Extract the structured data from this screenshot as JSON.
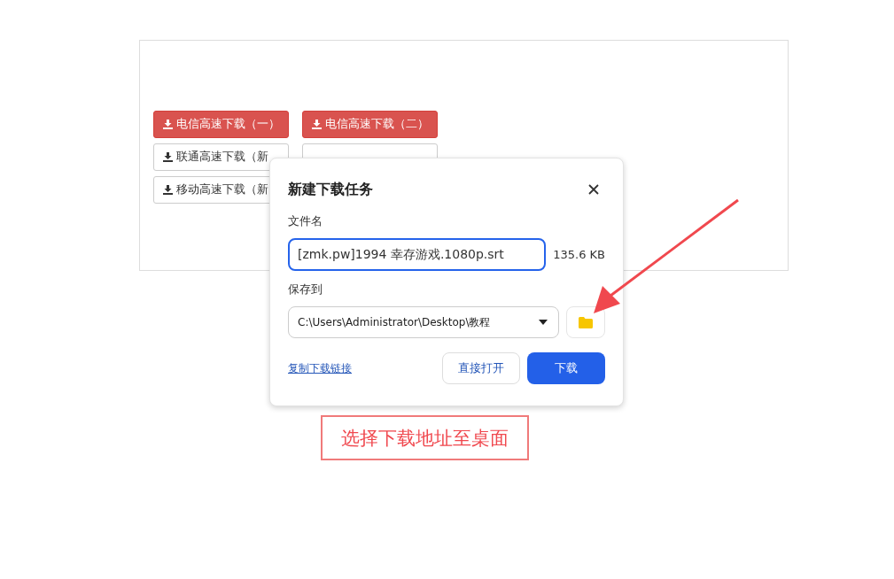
{
  "download_buttons": [
    {
      "label": "电信高速下载（一）",
      "kind": "primary"
    },
    {
      "label": "电信高速下载（二）",
      "kind": "primary"
    },
    {
      "label": "联通高速下载（新",
      "kind": "default"
    },
    {
      "kind": "covered"
    },
    {
      "label": "移动高速下载（新",
      "kind": "default"
    }
  ],
  "dialog": {
    "title": "新建下载任务",
    "filename_label": "文件名",
    "filename": "[zmk.pw]1994 幸存游戏.1080p.srt",
    "file_size": "135.6 KB",
    "save_label": "保存到",
    "save_path": "C:\\Users\\Administrator\\Desktop\\教程",
    "copy_link": "复制下载链接",
    "open_button": "直接打开",
    "download_button": "下载"
  },
  "annotation": {
    "text": "选择下载地址至桌面"
  }
}
